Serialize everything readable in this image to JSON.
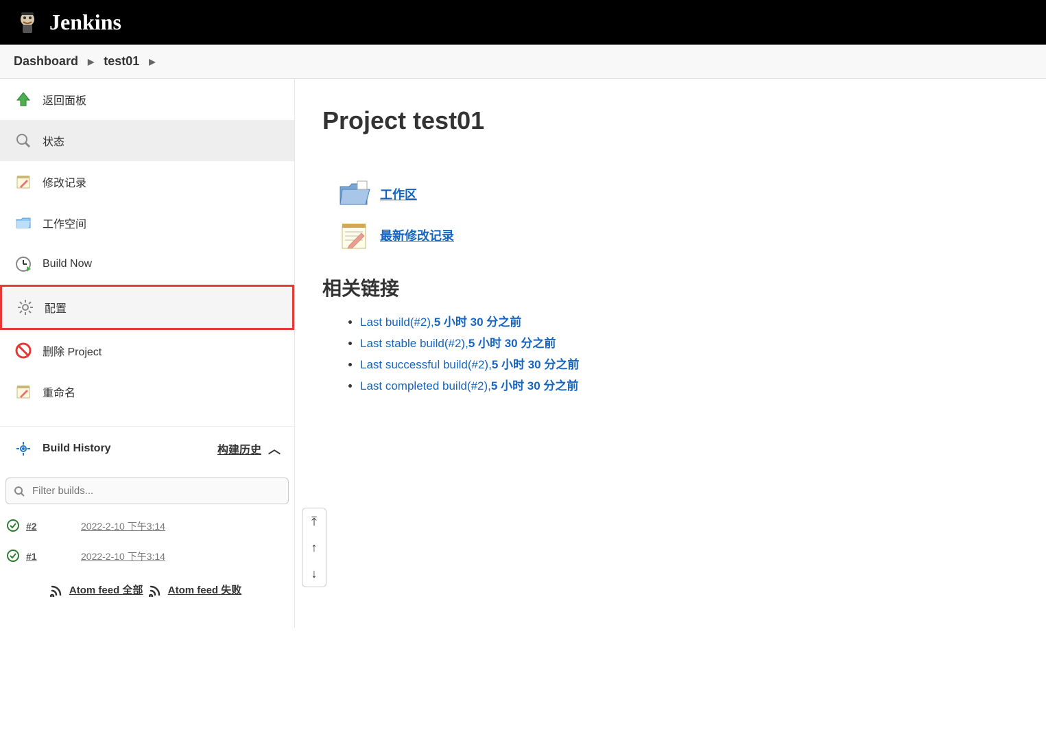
{
  "header": {
    "title": "Jenkins"
  },
  "breadcrumb": {
    "items": [
      "Dashboard",
      "test01"
    ]
  },
  "sidebar": {
    "items": [
      {
        "label": "返回面板",
        "icon": "arrow-up-green"
      },
      {
        "label": "状态",
        "icon": "magnifier",
        "active": true
      },
      {
        "label": "修改记录",
        "icon": "notepad"
      },
      {
        "label": "工作空间",
        "icon": "folder"
      },
      {
        "label": "Build Now",
        "icon": "clock-play"
      },
      {
        "label": "配置",
        "icon": "gear",
        "highlighted": true
      },
      {
        "label": "删除 Project",
        "icon": "no-entry"
      },
      {
        "label": "重命名",
        "icon": "notepad"
      }
    ]
  },
  "buildHistory": {
    "title": "Build History",
    "subtitle": "构建历史",
    "filterPlaceholder": "Filter builds...",
    "builds": [
      {
        "num": "#2",
        "date": "2022-2-10 下午3:14"
      },
      {
        "num": "#1",
        "date": "2022-2-10 下午3:14"
      }
    ],
    "feedAll": "Atom feed 全部",
    "feedFail": "Atom feed 失败"
  },
  "main": {
    "title": "Project test01",
    "workspaceLink": "工作区",
    "changesLink": "最新修改记录",
    "relatedHeading": "相关链接",
    "links": [
      {
        "prefix": "Last build(#2),",
        "bold": "5 小时 30 分之前"
      },
      {
        "prefix": "Last stable build(#2),",
        "bold": "5 小时 30 分之前"
      },
      {
        "prefix": "Last successful build(#2),",
        "bold": "5 小时 30 分之前"
      },
      {
        "prefix": "Last completed build(#2),",
        "bold": "5 小时 30 分之前"
      }
    ]
  }
}
